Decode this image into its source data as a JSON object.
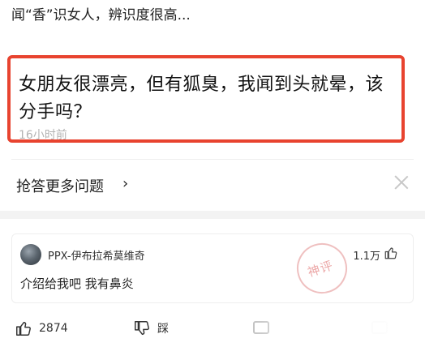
{
  "top_snippet": "闻“香”识女人，辨识度很高...",
  "question": {
    "title": "女朋友很漂亮，但有狐臭，我闻到头就晕，该分手吗？",
    "time": "16小时前"
  },
  "more_questions": {
    "label": "抢答更多问题",
    "chevron": "›"
  },
  "comment": {
    "username": "PPX-伊布拉希莫维奇",
    "like_count": "1.1万",
    "text": "介绍给我吧 我有鼻炎"
  },
  "watermark": "神评",
  "actions": {
    "like_count": "2874",
    "dislike_label": "踩"
  },
  "colors": {
    "highlight_border": "#e8432f",
    "muted_text": "#b3b3b3",
    "band": "#f3f3f3"
  }
}
